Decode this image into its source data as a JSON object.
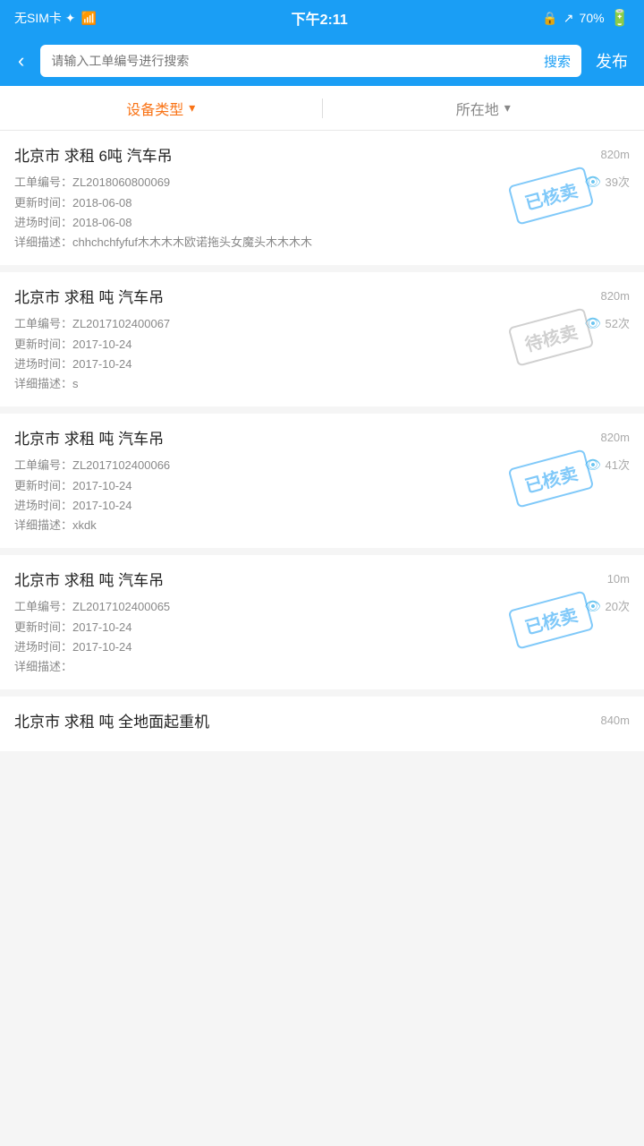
{
  "statusBar": {
    "left": "无SIM卡 ✦",
    "center": "下午2:11",
    "right": "70%",
    "lockIcon": "🔒",
    "arrowIcon": "↗",
    "batteryIcon": "▮"
  },
  "header": {
    "backLabel": "‹",
    "searchPlaceholder": "请输入工单编号进行搜索",
    "searchBtnLabel": "搜索",
    "publishLabel": "发布"
  },
  "filter": {
    "deviceType": "设备类型",
    "location": "所在地"
  },
  "items": [
    {
      "title": "北京市 求租 6吨 汽车吊",
      "distance": "820m",
      "workOrderNo": "工单编号：ZL2018060800069",
      "views": "39次",
      "updateTime": "更新时间：2018-06-08",
      "entryTime": "进场时间：2018-06-08",
      "description": "详细描述：chhchchfyfuf木木木木欧诺拖头女魔头木木木木",
      "stamp": "已核卖",
      "stampType": "sold"
    },
    {
      "title": "北京市 求租 吨 汽车吊",
      "distance": "820m",
      "workOrderNo": "工单编号：ZL2017102400067",
      "views": "52次",
      "updateTime": "更新时间：2017-10-24",
      "entryTime": "进场时间：2017-10-24",
      "description": "详细描述：s",
      "stamp": "待核卖",
      "stampType": "pending"
    },
    {
      "title": "北京市 求租 吨 汽车吊",
      "distance": "820m",
      "workOrderNo": "工单编号：ZL2017102400066",
      "views": "41次",
      "updateTime": "更新时间：2017-10-24",
      "entryTime": "进场时间：2017-10-24",
      "description": "详细描述：xkdk",
      "stamp": "已核卖",
      "stampType": "sold"
    },
    {
      "title": "北京市 求租 吨 汽车吊",
      "distance": "10m",
      "workOrderNo": "工单编号：ZL2017102400065",
      "views": "20次",
      "updateTime": "更新时间：2017-10-24",
      "entryTime": "进场时间：2017-10-24",
      "description": "详细描述：",
      "stamp": "已核卖",
      "stampType": "sold"
    },
    {
      "title": "北京市 求租 吨 全地面起重机",
      "distance": "840m",
      "workOrderNo": "",
      "views": "",
      "updateTime": "",
      "entryTime": "",
      "description": "",
      "stamp": "",
      "stampType": ""
    }
  ]
}
